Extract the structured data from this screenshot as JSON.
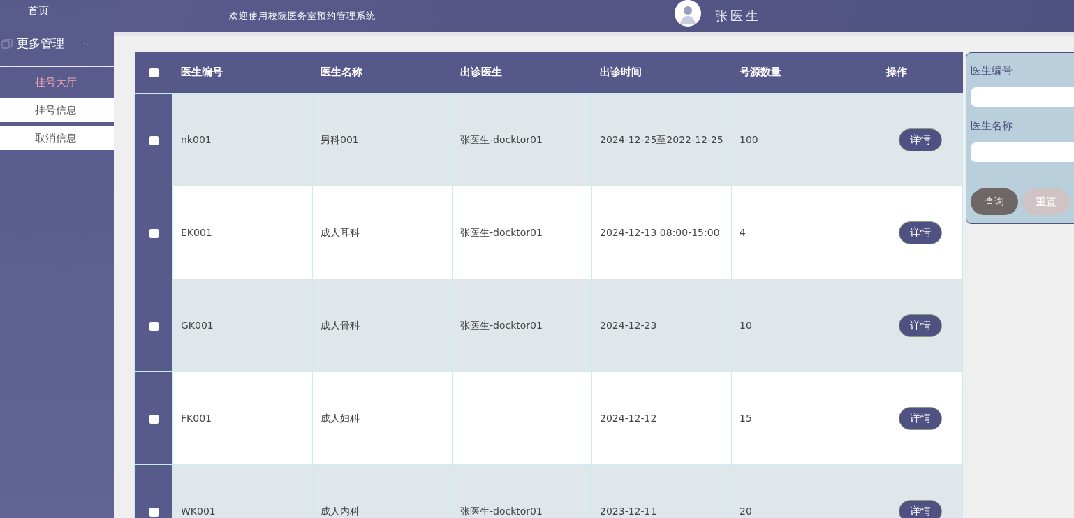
{
  "sidebar": {
    "items": [
      {
        "label": "首页",
        "kind": "link"
      },
      {
        "label": "更多管理",
        "kind": "group",
        "expanded": true,
        "children": [
          {
            "label": "挂号大厅",
            "selected": true
          },
          {
            "label": "挂号信息",
            "selected": false
          },
          {
            "label": "取消信息",
            "selected": false
          }
        ]
      }
    ]
  },
  "header": {
    "title": "欢迎使用校院医务室预约管理系统",
    "user": "张医生"
  },
  "table": {
    "select_all": {
      "checked": false
    },
    "columns": [
      "医生编号",
      "医生名称",
      "出诊医生",
      "出诊时间",
      "号源数量",
      "操作"
    ],
    "rows": [
      {
        "checked": false,
        "cells": [
          "nk001",
          "男科001",
          "张医生-docktor01",
          "2024-12-25至2022-12-25",
          "100"
        ],
        "action": "详情"
      },
      {
        "checked": false,
        "cells": [
          "EK001",
          "成人耳科",
          "张医生-docktor01",
          "2024-12-13 08:00-15:00",
          "4"
        ],
        "action": "详情"
      },
      {
        "checked": false,
        "cells": [
          "GK001",
          "成人骨科",
          "张医生-docktor01",
          "2024-12-23",
          "10"
        ],
        "action": "详情"
      },
      {
        "checked": false,
        "cells": [
          "FK001",
          "成人妇科",
          "",
          "2024-12-12",
          "15"
        ],
        "action": "详情"
      },
      {
        "checked": false,
        "cells": [
          "WK001",
          "成人内科",
          "张医生-docktor01",
          "2023-12-11",
          "20"
        ],
        "action": "详情"
      }
    ]
  },
  "search_panel": {
    "fields": [
      {
        "label": "医生编号"
      },
      {
        "label": "医生名称"
      }
    ],
    "buttons": [
      {
        "label": "查询",
        "kind": "primary"
      },
      {
        "label": "重置",
        "kind": "secondary"
      }
    ]
  }
}
